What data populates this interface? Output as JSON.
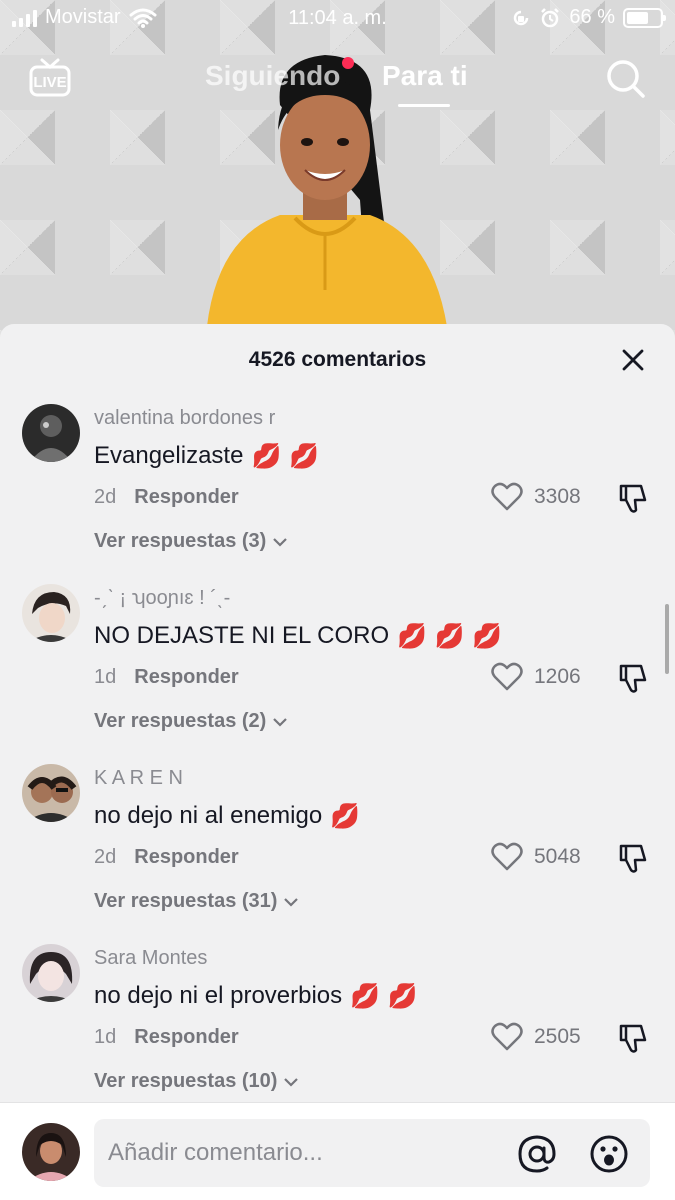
{
  "status_bar": {
    "carrier": "Movistar",
    "time": "11:04 a. m.",
    "battery": "66 %",
    "battery_level": 0.66
  },
  "top_nav": {
    "live_label": "LIVE",
    "tabs": [
      {
        "label": "Siguiendo"
      },
      {
        "label": "Para ti"
      }
    ]
  },
  "comments_panel": {
    "title": "4526 comentarios",
    "comments": [
      {
        "user": "valentina bordones r",
        "text": "Evangelizaste",
        "emoji": "💋 💋",
        "age": "2d",
        "reply_label": "Responder",
        "likes": "3308",
        "view_replies": "Ver respuestas (3)"
      },
      {
        "user": "-ˏˋ ¡ ʮooɲıɛ ! ´ˎ-",
        "text": "NO DEJASTE NI EL CORO",
        "emoji": "💋 💋 💋",
        "age": "1d",
        "reply_label": "Responder",
        "likes": "1206",
        "view_replies": "Ver respuestas (2)"
      },
      {
        "user": "K A R E N",
        "text": "no dejo ni al enemigo",
        "emoji": "💋",
        "age": "2d",
        "reply_label": "Responder",
        "likes": "5048",
        "view_replies": "Ver respuestas (31)"
      },
      {
        "user": "Sara Montes",
        "text": "no dejo ni el proverbios",
        "emoji": "💋 💋",
        "age": "1d",
        "reply_label": "Responder",
        "likes": "2505",
        "view_replies": "Ver respuestas (10)"
      }
    ]
  },
  "composer": {
    "placeholder": "Añadir comentario..."
  },
  "colors": {
    "accent_red": "#fe2c55",
    "sheet_bg": "#f1f1f2",
    "text_primary": "#161823",
    "text_secondary": "#8a8b91"
  }
}
